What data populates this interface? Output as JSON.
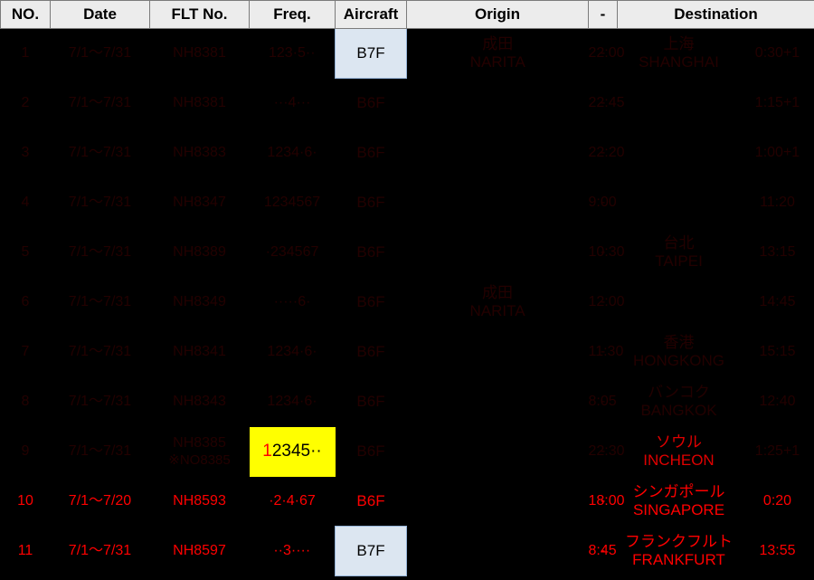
{
  "table": {
    "headers": [
      {
        "key": "no",
        "label": "NO."
      },
      {
        "key": "date",
        "label": "Date"
      },
      {
        "key": "flt",
        "label": "FLT No."
      },
      {
        "key": "freq",
        "label": "Freq."
      },
      {
        "key": "aircraft",
        "label": "Aircraft"
      },
      {
        "key": "origin",
        "label": "Origin"
      },
      {
        "key": "dash",
        "label": "-"
      },
      {
        "key": "destination",
        "label": "Destination"
      }
    ],
    "rows": [
      {
        "no": "1",
        "date": "7/1〜7/31",
        "flt": "NH8381",
        "flt_note": "",
        "freq": "123·5··",
        "aircraft": "B7F",
        "origin_jp": "成田",
        "origin_en": "NARITA",
        "dep": "22:00",
        "dash": "-",
        "dest_jp": "上海",
        "dest_en": "SHANGHAI",
        "arr": "0:30+1",
        "aircraft_highlight": true,
        "freq_highlight": false,
        "dest_bright": false
      },
      {
        "no": "2",
        "date": "7/1〜7/31",
        "flt": "NH8381",
        "flt_note": "",
        "freq": "···4···",
        "aircraft": "B6F",
        "origin_jp": "",
        "origin_en": "",
        "dep": "22:45",
        "dash": "-",
        "dest_jp": "",
        "dest_en": "",
        "arr": "1:15+1",
        "aircraft_highlight": false,
        "freq_highlight": false,
        "dest_bright": false
      },
      {
        "no": "3",
        "date": "7/1〜7/31",
        "flt": "NH8383",
        "flt_note": "",
        "freq": "1234·6·",
        "aircraft": "B6F",
        "origin_jp": "",
        "origin_en": "",
        "dep": "22:20",
        "dash": "-",
        "dest_jp": "",
        "dest_en": "",
        "arr": "1:00+1",
        "aircraft_highlight": false,
        "freq_highlight": false,
        "dest_bright": false
      },
      {
        "no": "4",
        "date": "7/1〜7/31",
        "flt": "NH8347",
        "flt_note": "",
        "freq": "1234567",
        "aircraft": "B6F",
        "origin_jp": "",
        "origin_en": "",
        "dep": "9:00",
        "dash": "-",
        "dest_jp": "",
        "dest_en": "",
        "arr": "11:20",
        "aircraft_highlight": false,
        "freq_highlight": false,
        "dest_bright": false
      },
      {
        "no": "5",
        "date": "7/1〜7/31",
        "flt": "NH8389",
        "flt_note": "",
        "freq": "·234567",
        "aircraft": "B6F",
        "origin_jp": "",
        "origin_en": "",
        "dep": "10:30",
        "dash": "-",
        "dest_jp": "台北",
        "dest_en": "TAIPEI",
        "arr": "13:15",
        "aircraft_highlight": false,
        "freq_highlight": false,
        "dest_bright": false
      },
      {
        "no": "6",
        "date": "7/1〜7/31",
        "flt": "NH8349",
        "flt_note": "",
        "freq": "·····6·",
        "aircraft": "B6F",
        "origin_jp": "成田",
        "origin_en": "NARITA",
        "dep": "12:00",
        "dash": "-",
        "dest_jp": "",
        "dest_en": "",
        "arr": "14:45",
        "aircraft_highlight": false,
        "freq_highlight": false,
        "dest_bright": false
      },
      {
        "no": "7",
        "date": "7/1〜7/31",
        "flt": "NH8341",
        "flt_note": "",
        "freq": "1234·6·",
        "aircraft": "B6F",
        "origin_jp": "",
        "origin_en": "",
        "dep": "11:30",
        "dash": "-",
        "dest_jp": "香港",
        "dest_en": "HONGKONG",
        "arr": "15:15",
        "aircraft_highlight": false,
        "freq_highlight": false,
        "dest_bright": false
      },
      {
        "no": "8",
        "date": "7/1〜7/31",
        "flt": "NH8343",
        "flt_note": "",
        "freq": "1234·6·",
        "aircraft": "B6F",
        "origin_jp": "",
        "origin_en": "",
        "dep": "8:05",
        "dash": "-",
        "dest_jp": "バンコク",
        "dest_en": "BANGKOK",
        "arr": "12:40",
        "aircraft_highlight": false,
        "freq_highlight": false,
        "dest_bright": false
      },
      {
        "no": "9",
        "date": "7/1〜7/31",
        "flt": "NH8385",
        "flt_note": "※NO8385",
        "freq": "12345··",
        "freq_first": "1",
        "freq_rest": "2345··",
        "aircraft": "B6F",
        "origin_jp": "",
        "origin_en": "",
        "dep": "22:30",
        "dash": "-",
        "dest_jp": "ソウル",
        "dest_en": "INCHEON",
        "arr": "1:25+1",
        "aircraft_highlight": false,
        "freq_highlight": true,
        "dest_bright": true
      },
      {
        "no": "10",
        "date": "7/1〜7/20",
        "flt": "NH8593",
        "flt_note": "",
        "freq": "·2·4·67",
        "aircraft": "B6F",
        "origin_jp": "",
        "origin_en": "",
        "dep": "18:00",
        "dash": "-",
        "dest_jp": "シンガポール",
        "dest_en": "SINGAPORE",
        "arr": "0:20",
        "aircraft_highlight": false,
        "freq_highlight": false,
        "dest_bright": false
      },
      {
        "no": "11",
        "date": "7/1〜7/31",
        "flt": "NH8597",
        "flt_note": "",
        "freq": "··3····",
        "aircraft": "B7F",
        "origin_jp": "",
        "origin_en": "",
        "dep": "8:45",
        "dash": "-",
        "dest_jp": "フランクフルト",
        "dest_en": "FRANKFURT",
        "arr": "13:55",
        "aircraft_highlight": true,
        "freq_highlight": false,
        "dest_bright": false
      }
    ]
  },
  "colors": {
    "background": "#000000",
    "header_bg": "#ececec",
    "dim_text": "#230000",
    "bright_text": "#ff0000",
    "highlight_yellow": "#ffff00",
    "highlight_blue": "#dce6f1"
  }
}
